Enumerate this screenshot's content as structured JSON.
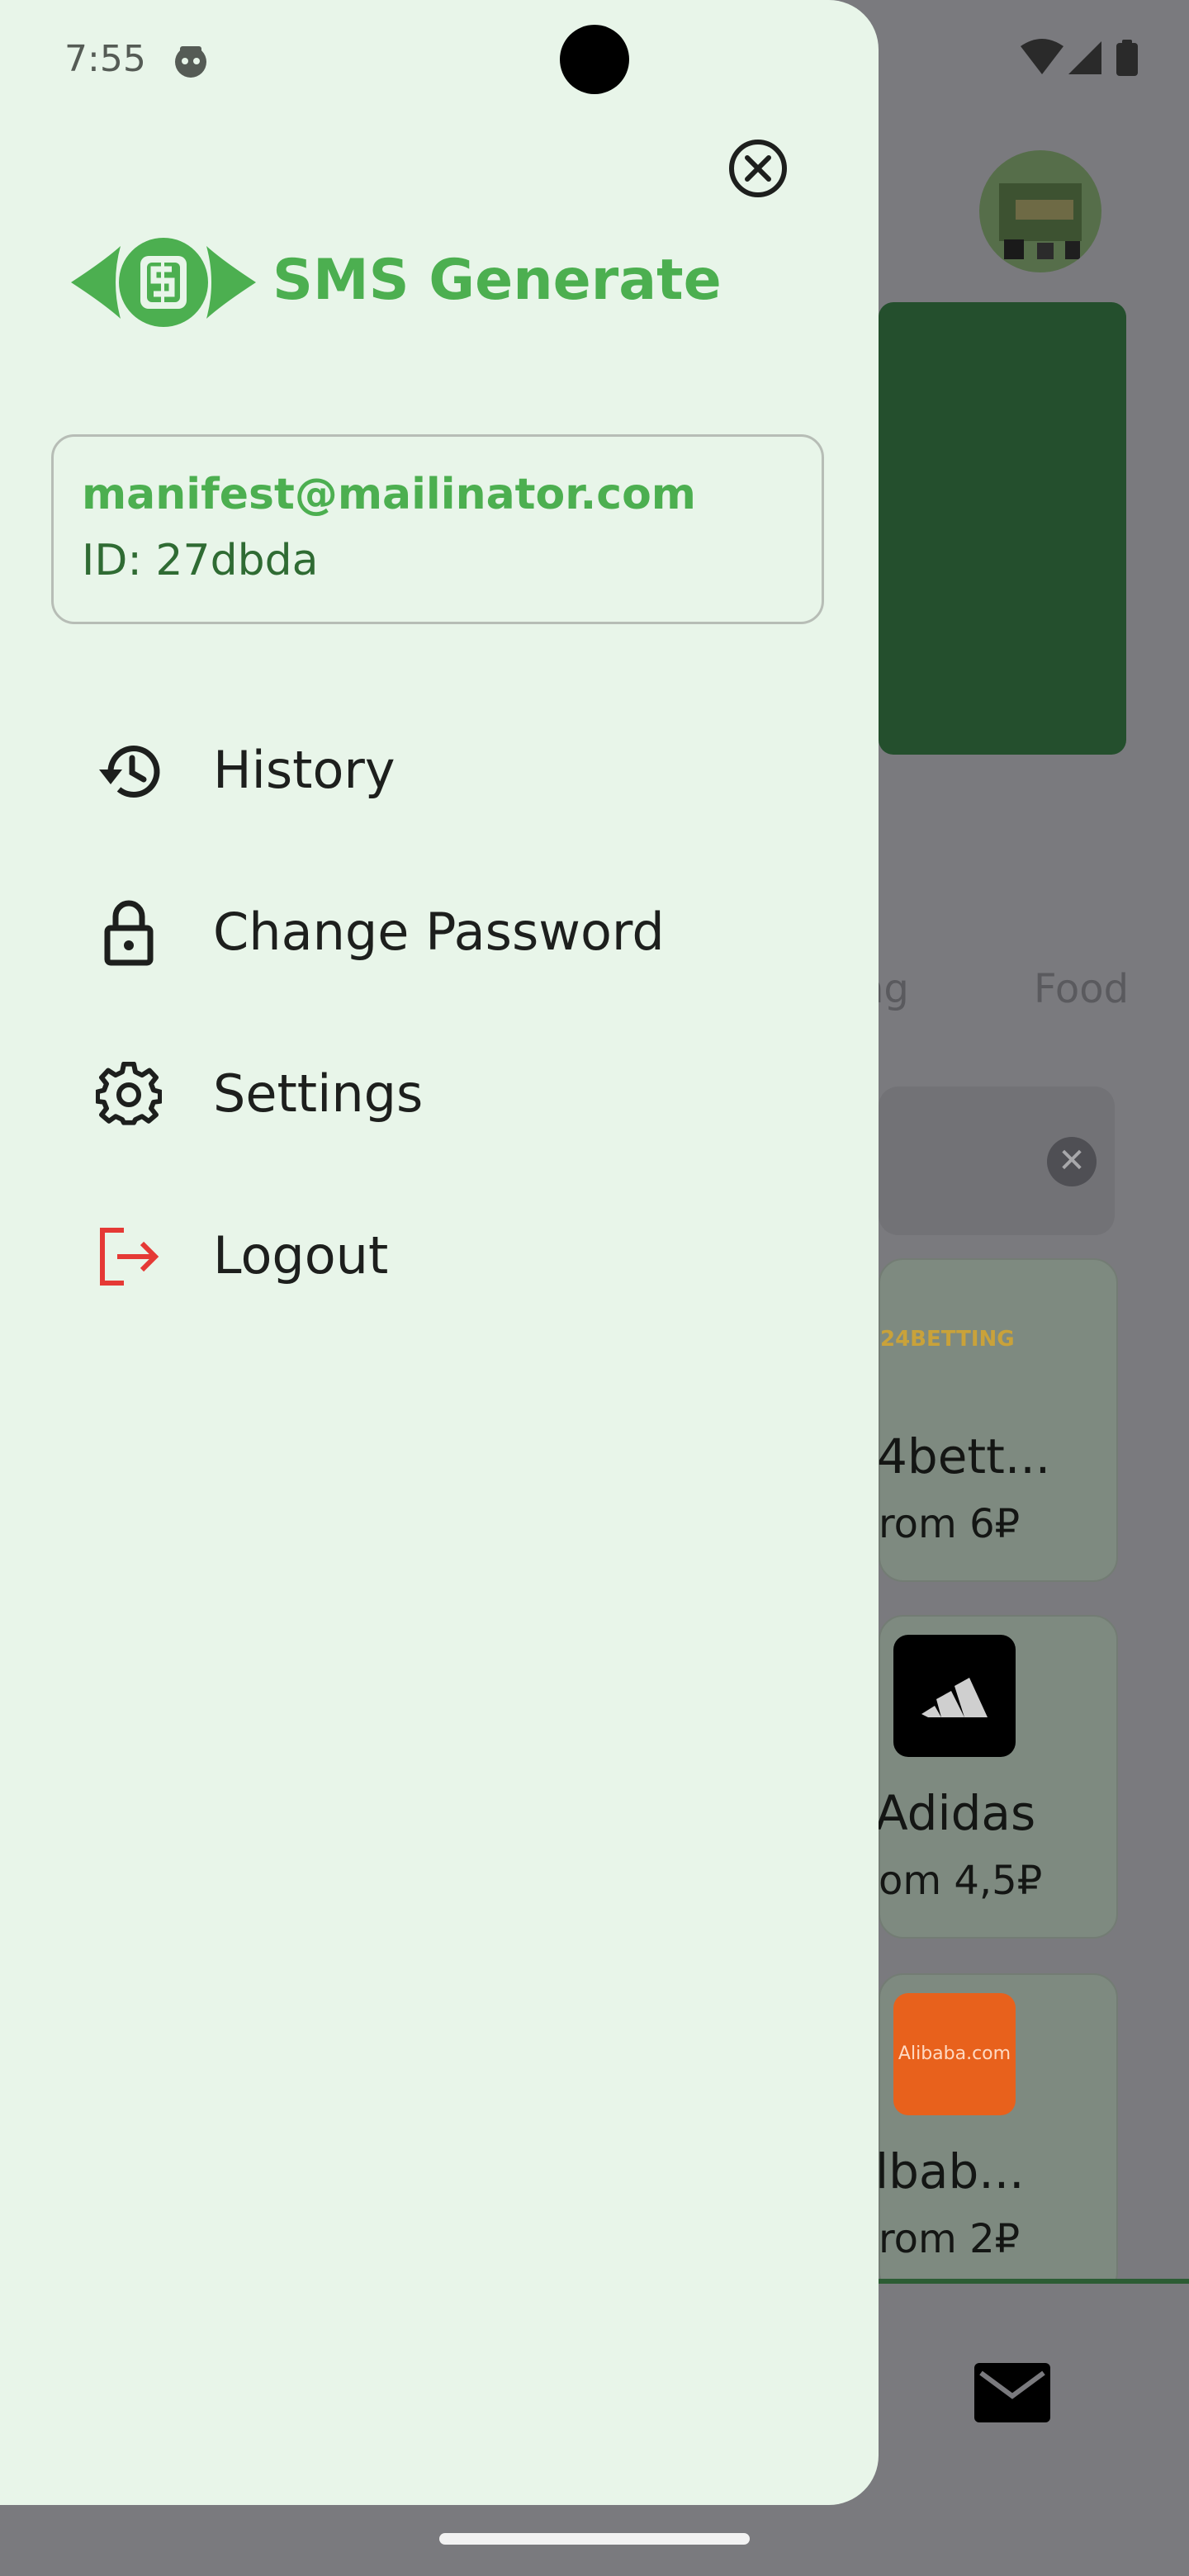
{
  "status_bar": {
    "time": "7:55"
  },
  "background": {
    "tabs": [
      "ng",
      "Food"
    ],
    "cards": [
      {
        "logo_text": "24BETTING",
        "name": "4bett...",
        "price": "rom 6₽"
      },
      {
        "logo_text": "",
        "name": "Adidas",
        "price": "om 4,5₽"
      },
      {
        "logo_text": "Alibaba.com",
        "name": "lbab...",
        "price": "rom 2₽"
      }
    ]
  },
  "drawer": {
    "brand": {
      "name": "SMS Generate"
    },
    "account": {
      "email": "manifest@mailinator.com",
      "id": "ID: 27dbda"
    },
    "menu": [
      {
        "label": "History",
        "icon": "history-icon"
      },
      {
        "label": "Change Password",
        "icon": "lock-icon"
      },
      {
        "label": "Settings",
        "icon": "gear-icon"
      },
      {
        "label": "Logout",
        "icon": "logout-icon"
      }
    ]
  },
  "colors": {
    "drawer_bg": "#e8f5e9",
    "brand_green": "#4caf50",
    "id_green": "#2f6b33",
    "logout_red": "#e53935",
    "scrim": "#7a7a7e"
  }
}
